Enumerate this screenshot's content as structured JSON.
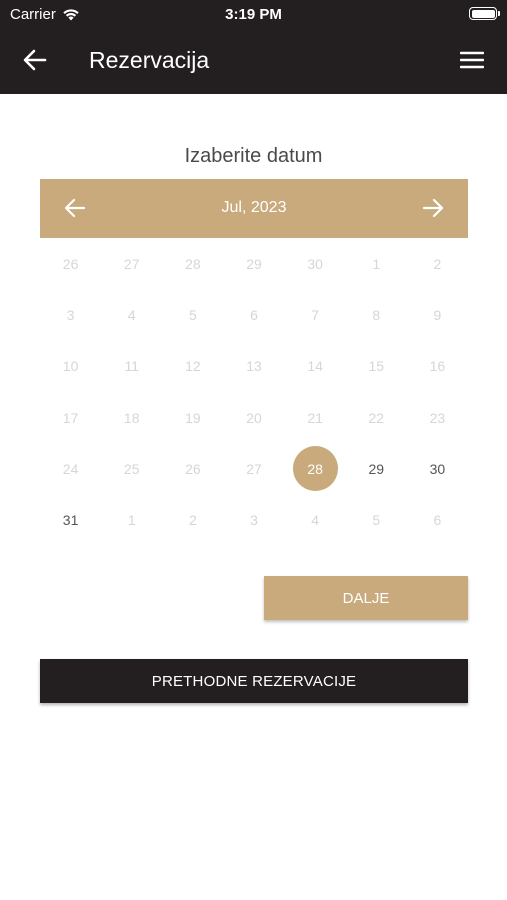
{
  "status_bar": {
    "carrier": "Carrier",
    "time": "3:19 PM"
  },
  "nav": {
    "title": "Rezervacija",
    "back_icon": "arrow-left-icon",
    "menu_icon": "hamburger-menu-icon"
  },
  "calendar": {
    "heading": "Izaberite datum",
    "month_label": "Jul, 2023",
    "selected_day": "28",
    "days": [
      {
        "label": "26",
        "state": "disabled"
      },
      {
        "label": "27",
        "state": "disabled"
      },
      {
        "label": "28",
        "state": "disabled"
      },
      {
        "label": "29",
        "state": "disabled"
      },
      {
        "label": "30",
        "state": "disabled"
      },
      {
        "label": "1",
        "state": "disabled"
      },
      {
        "label": "2",
        "state": "disabled"
      },
      {
        "label": "3",
        "state": "disabled"
      },
      {
        "label": "4",
        "state": "disabled"
      },
      {
        "label": "5",
        "state": "disabled"
      },
      {
        "label": "6",
        "state": "disabled"
      },
      {
        "label": "7",
        "state": "disabled"
      },
      {
        "label": "8",
        "state": "disabled"
      },
      {
        "label": "9",
        "state": "disabled"
      },
      {
        "label": "10",
        "state": "disabled"
      },
      {
        "label": "11",
        "state": "disabled"
      },
      {
        "label": "12",
        "state": "disabled"
      },
      {
        "label": "13",
        "state": "disabled"
      },
      {
        "label": "14",
        "state": "disabled"
      },
      {
        "label": "15",
        "state": "disabled"
      },
      {
        "label": "16",
        "state": "disabled"
      },
      {
        "label": "17",
        "state": "disabled"
      },
      {
        "label": "18",
        "state": "disabled"
      },
      {
        "label": "19",
        "state": "disabled"
      },
      {
        "label": "20",
        "state": "disabled"
      },
      {
        "label": "21",
        "state": "disabled"
      },
      {
        "label": "22",
        "state": "disabled"
      },
      {
        "label": "23",
        "state": "disabled"
      },
      {
        "label": "24",
        "state": "disabled"
      },
      {
        "label": "25",
        "state": "disabled"
      },
      {
        "label": "26",
        "state": "disabled"
      },
      {
        "label": "27",
        "state": "disabled"
      },
      {
        "label": "28",
        "state": "selected"
      },
      {
        "label": "29",
        "state": "active"
      },
      {
        "label": "30",
        "state": "active"
      },
      {
        "label": "31",
        "state": "active"
      },
      {
        "label": "1",
        "state": "disabled"
      },
      {
        "label": "2",
        "state": "disabled"
      },
      {
        "label": "3",
        "state": "disabled"
      },
      {
        "label": "4",
        "state": "disabled"
      },
      {
        "label": "5",
        "state": "disabled"
      },
      {
        "label": "6",
        "state": "disabled"
      }
    ]
  },
  "buttons": {
    "next_label": "DALJE",
    "previous_reservations_label": "PRETHODNE REZERVACIJE"
  },
  "colors": {
    "accent": "#c9aa7c",
    "dark": "#231f20"
  }
}
